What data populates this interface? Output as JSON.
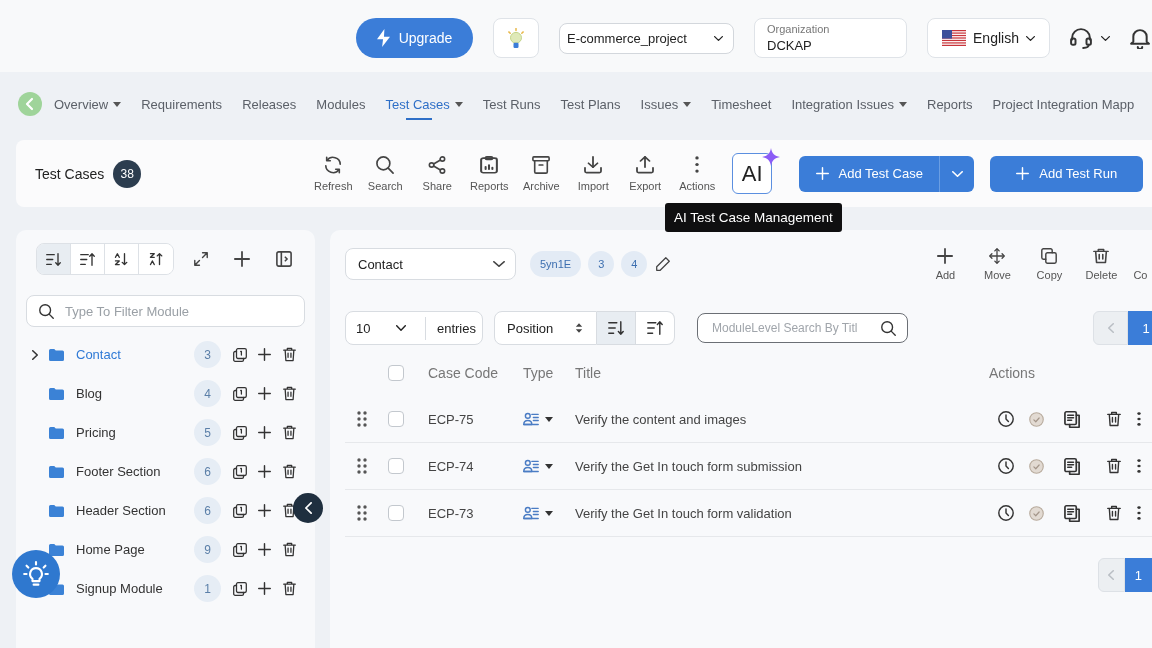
{
  "header": {
    "upgrade": {
      "label": "Upgrade"
    },
    "project": {
      "value": "E-commerce_project"
    },
    "organization": {
      "label": "Organization",
      "value": "DCKAP"
    },
    "language": {
      "label": "English"
    }
  },
  "nav": {
    "items": [
      {
        "label": "Overview",
        "dropdown": true,
        "selected": false
      },
      {
        "label": "Requirements",
        "dropdown": false,
        "selected": false
      },
      {
        "label": "Releases",
        "dropdown": false,
        "selected": false
      },
      {
        "label": "Modules",
        "dropdown": false,
        "selected": false
      },
      {
        "label": "Test Cases",
        "dropdown": true,
        "selected": true
      },
      {
        "label": "Test Runs",
        "dropdown": false,
        "selected": false
      },
      {
        "label": "Test Plans",
        "dropdown": false,
        "selected": false
      },
      {
        "label": "Issues",
        "dropdown": true,
        "selected": false
      },
      {
        "label": "Timesheet",
        "dropdown": false,
        "selected": false
      },
      {
        "label": "Integration Issues",
        "dropdown": true,
        "selected": false
      },
      {
        "label": "Reports",
        "dropdown": false,
        "selected": false
      },
      {
        "label": "Project Integration Mapp",
        "dropdown": false,
        "selected": false
      }
    ]
  },
  "toolbar": {
    "title": "Test Cases",
    "count": "38",
    "actions": [
      {
        "label": "Refresh",
        "kind": "refresh"
      },
      {
        "label": "Search",
        "kind": "search"
      },
      {
        "label": "Share",
        "kind": "share"
      },
      {
        "label": "Reports",
        "kind": "reports"
      },
      {
        "label": "Archive",
        "kind": "archive"
      },
      {
        "label": "Import",
        "kind": "import"
      },
      {
        "label": "Export",
        "kind": "export"
      },
      {
        "label": "Actions",
        "kind": "more"
      }
    ],
    "ai_button": {
      "label": "AI",
      "tooltip": "AI Test Case Management"
    },
    "buttons": [
      {
        "label": "Add Test Case",
        "split": true
      },
      {
        "label": "Add Test Run",
        "split": false
      }
    ]
  },
  "module_panel": {
    "sort_buttons": [
      {
        "kind": "desc",
        "selected": true
      },
      {
        "kind": "asc",
        "selected": false
      },
      {
        "kind": "az",
        "selected": false
      },
      {
        "kind": "za",
        "selected": false
      }
    ],
    "filter": {
      "placeholder": "Type To Filter Module"
    },
    "modules": [
      {
        "name": "Contact",
        "count": "3",
        "selected": true,
        "expandable": true
      },
      {
        "name": "Blog",
        "count": "4",
        "selected": false,
        "expandable": false
      },
      {
        "name": "Pricing",
        "count": "5",
        "selected": false,
        "expandable": false
      },
      {
        "name": "Footer Section",
        "count": "6",
        "selected": false,
        "expandable": false
      },
      {
        "name": "Header Section",
        "count": "6",
        "selected": false,
        "expandable": false
      },
      {
        "name": "Home Page",
        "count": "9",
        "selected": false,
        "expandable": false
      },
      {
        "name": "Signup Module",
        "count": "1",
        "selected": false,
        "expandable": false
      }
    ]
  },
  "content": {
    "module_select": {
      "value": "Contact"
    },
    "tags": [
      {
        "label": "5yn1E"
      },
      {
        "label": "3"
      },
      {
        "label": "4"
      }
    ],
    "actions": [
      {
        "label": "Add",
        "kind": "add"
      },
      {
        "label": "Move",
        "kind": "move"
      },
      {
        "label": "Copy",
        "kind": "copy"
      },
      {
        "label": "Delete",
        "kind": "delete"
      },
      {
        "label": "Co"
      }
    ],
    "page_size": {
      "value": "10",
      "suffix": "entries"
    },
    "sort_field": {
      "value": "Position"
    },
    "order_buttons": [
      {
        "kind": "desc",
        "selected": true
      },
      {
        "kind": "asc",
        "selected": false
      }
    ],
    "search": {
      "placeholder": "ModuleLevel Search By Titl"
    },
    "pagination_top": {
      "pages": [
        {
          "label": "1",
          "selected": true
        }
      ]
    },
    "table": {
      "select_all_checked": false,
      "columns": [
        "Case Code",
        "Type",
        "Title",
        "Actions"
      ],
      "rows": [
        {
          "case_code": "ECP-75",
          "title": "Verify the content and images",
          "checked": false
        },
        {
          "case_code": "ECP-74",
          "title": "Verify the Get In touch form submission",
          "checked": false
        },
        {
          "case_code": "ECP-73",
          "title": "Verify the Get In touch form validation",
          "checked": false
        }
      ]
    },
    "pagination_bottom": {
      "pages": [
        {
          "label": "1",
          "selected": true
        }
      ]
    }
  }
}
